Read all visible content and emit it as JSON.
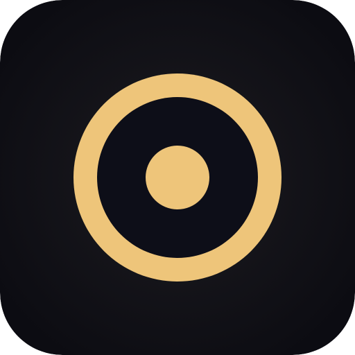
{
  "icon": {
    "name": "target-icon",
    "colors": {
      "background_center": "#1c1b20",
      "background_edge": "#0c0c12",
      "ring_gold": "#eec57a",
      "inner_dark": "#0d0e18",
      "center_dot_gold": "#eec57a"
    }
  }
}
